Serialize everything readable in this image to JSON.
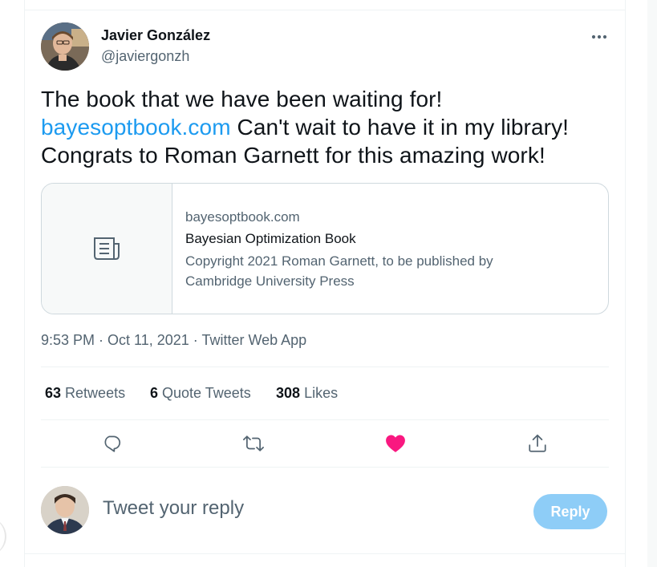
{
  "author": {
    "name": "Javier González",
    "handle": "@javiergonzh"
  },
  "tweet": {
    "text_line1": "The book that we have been waiting for!",
    "link": "bayesoptbook.com",
    "text_after_link": " Can't wait to have it in my library!",
    "text_line3": "Congrats to Roman Garnett for this amazing work!"
  },
  "card": {
    "domain": "bayesoptbook.com",
    "title": "Bayesian Optimization Book",
    "description": "Copyright 2021 Roman Garnett, to be published by Cambridge University Press",
    "thumb_icon": "article-icon"
  },
  "meta": {
    "time": "9:53 PM",
    "date": "Oct 11, 2021",
    "source": "Twitter Web App",
    "separator": " · "
  },
  "stats": {
    "retweets_count": "63",
    "retweets_label": "Retweets",
    "quotes_count": "6",
    "quotes_label": "Quote Tweets",
    "likes_count": "308",
    "likes_label": "Likes"
  },
  "actions": {
    "icons": [
      "reply-icon",
      "retweet-icon",
      "like-icon",
      "share-icon"
    ],
    "liked": true,
    "like_color": "#f91880",
    "icon_color": "#536471"
  },
  "reply": {
    "placeholder": "Tweet your reply",
    "button_label": "Reply",
    "button_color": "#8ecdf7"
  },
  "colors": {
    "link": "#1d9bf0",
    "secondary_text": "#536471",
    "primary_text": "#0f1419"
  }
}
